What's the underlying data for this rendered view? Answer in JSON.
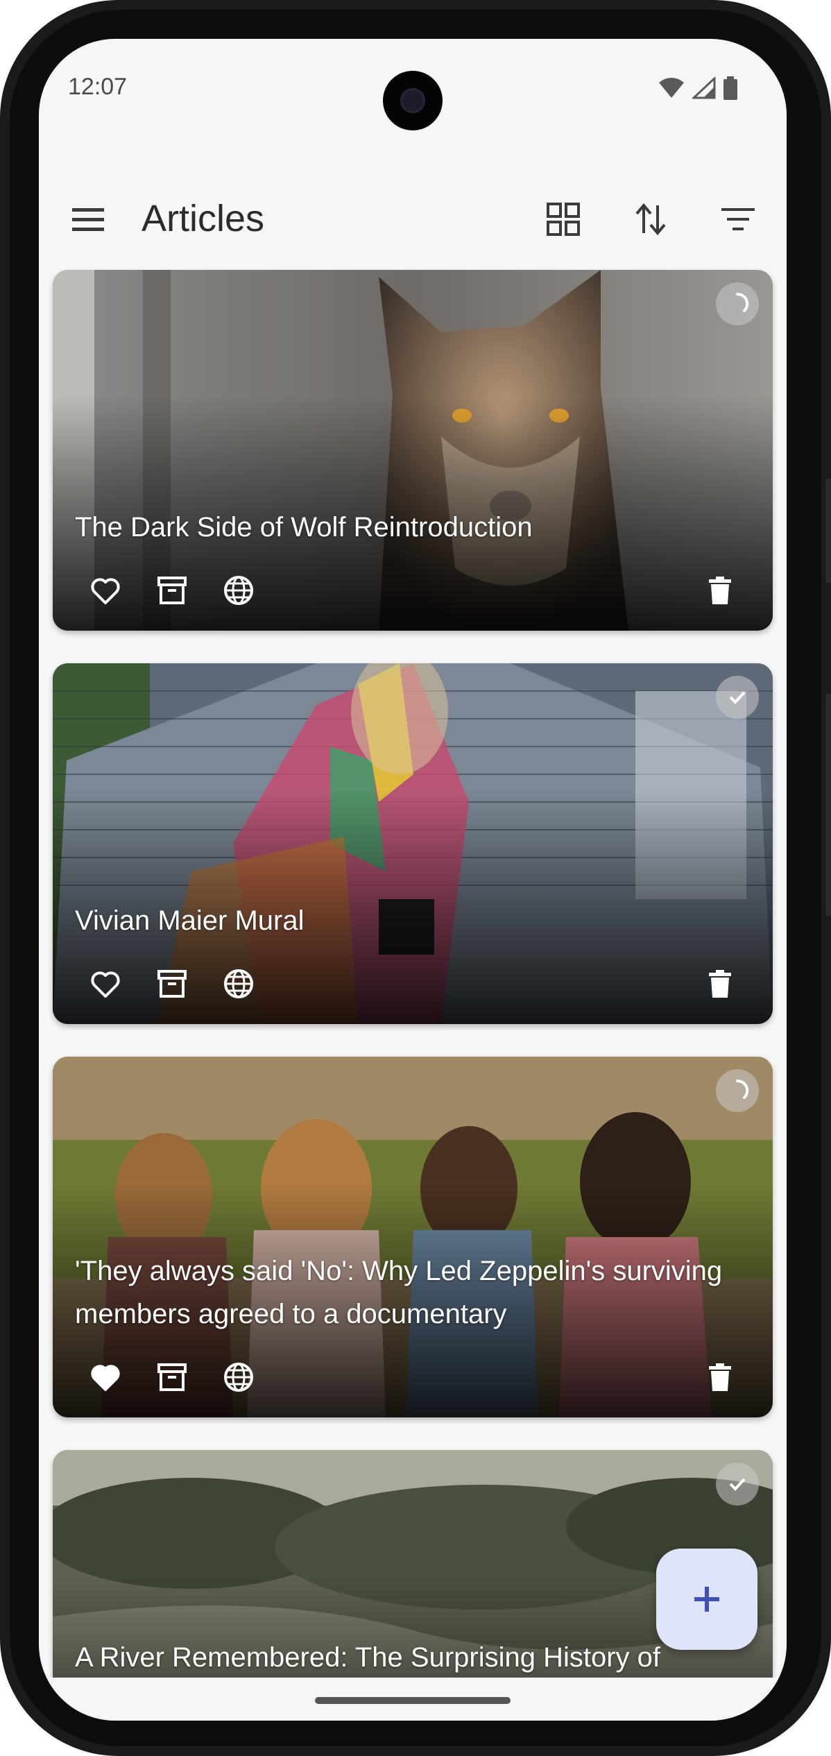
{
  "status_bar": {
    "time": "12:07"
  },
  "app_bar": {
    "title": "Articles",
    "icons": [
      "menu-icon",
      "grid-view-icon",
      "sort-icon",
      "filter-icon"
    ]
  },
  "articles": [
    {
      "title": "The Dark Side of Wolf Reintroduction",
      "favorited": false,
      "status": "loading"
    },
    {
      "title": "Vivian Maier Mural",
      "favorited": false,
      "status": "done"
    },
    {
      "title": "'They always said 'No': Why Led Zeppelin's surviving members agreed to a documentary",
      "favorited": true,
      "status": "loading"
    },
    {
      "title": "A River Remembered: The Surprising History of",
      "favorited": false,
      "status": "done"
    }
  ],
  "fab": {
    "icon": "plus-icon"
  },
  "colors": {
    "screen_bg": "#f6f6f6",
    "fab_bg": "#dfe4f9",
    "fab_icon": "#3f51b5"
  }
}
